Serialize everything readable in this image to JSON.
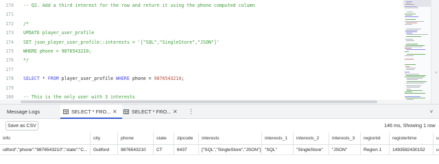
{
  "editor": {
    "lines": [
      {
        "num": "170",
        "tokens": [
          {
            "t": "-- Q2. Add a third interest for the row and return it using the phone computed column",
            "k": "comment"
          }
        ]
      },
      {
        "num": "171",
        "tokens": []
      },
      {
        "num": "172",
        "tokens": [
          {
            "t": "/*",
            "k": "comment"
          }
        ]
      },
      {
        "num": "173",
        "tokens": [
          {
            "t": "UPDATE player_user_profile",
            "k": "comment"
          }
        ]
      },
      {
        "num": "174",
        "tokens": [
          {
            "t": "SET json_player_user_profile::interests = '[\"SQL\",\"SingleStore\",\"JSON\"]'",
            "k": "comment"
          }
        ]
      },
      {
        "num": "175",
        "tokens": [
          {
            "t": "WHERE phone = 9876543210;",
            "k": "comment"
          }
        ]
      },
      {
        "num": "176",
        "tokens": [
          {
            "t": "*/",
            "k": "comment"
          }
        ]
      },
      {
        "num": "177",
        "tokens": []
      },
      {
        "num": "178",
        "tokens": [
          {
            "t": "SELECT",
            "k": "keyword"
          },
          {
            "t": " * ",
            "k": "plain"
          },
          {
            "t": "FROM",
            "k": "keyword"
          },
          {
            "t": " player_user_profile ",
            "k": "plain"
          },
          {
            "t": "WHERE",
            "k": "keyword"
          },
          {
            "t": " phone = ",
            "k": "plain"
          },
          {
            "t": "9876543210",
            "k": "number"
          },
          {
            "t": ";",
            "k": "plain"
          }
        ]
      },
      {
        "num": "179",
        "tokens": []
      },
      {
        "num": "180",
        "tokens": [
          {
            "t": "-- This is the only user with 3 interests",
            "k": "comment"
          }
        ]
      },
      {
        "num": "181",
        "tokens": [
          {
            "t": "SELECT",
            "k": "keyword"
          },
          {
            "t": " * ",
            "k": "plain"
          },
          {
            "t": "FROM",
            "k": "keyword"
          },
          {
            "t": " player_user_profile ",
            "k": "plain"
          },
          {
            "t": "WHERE",
            "k": "keyword"
          },
          {
            "t": " JSON_LENGTH(interests) = ",
            "k": "plain"
          },
          {
            "t": "3",
            "k": "number"
          },
          {
            "t": ";",
            "k": "plain"
          }
        ]
      },
      {
        "num": "182",
        "tokens": []
      },
      {
        "num": "183",
        "tokens": []
      }
    ]
  },
  "tabs": [
    {
      "label": "Message Logs",
      "active": false,
      "has_icon": false,
      "has_close": false
    },
    {
      "label": "SELECT * FRO...",
      "active": true,
      "has_icon": true,
      "has_close": true
    },
    {
      "label": "SELECT * FRO...",
      "active": false,
      "has_icon": true,
      "has_close": true
    }
  ],
  "tab_overflow_icon": "⋮",
  "collapse_icon": "˅",
  "toolbar": {
    "save_csv_label": "Save as CSV",
    "status": "146 ms, Showing 1 row"
  },
  "results": {
    "columns": [
      "info",
      "city",
      "phone",
      "state",
      "zipcode",
      "interests",
      "interests_1",
      "interests_2",
      "interests_3",
      "regionId",
      "registertime",
      "us"
    ],
    "rows": [
      [
        "uilford\",\"phone\":\"9876543210\",\"state\":\"C...",
        "Guilford",
        "9876543210",
        "CT",
        "6437",
        "[\"SQL\",\"SingleStore\",\"JSON\"]",
        "\"SQL\"",
        "\"SingleStore\"",
        "\"JSON\"",
        "Region 1",
        "1493582430152",
        "u"
      ]
    ]
  },
  "colors": {
    "comment": "#3d9b38",
    "keyword": "#4a4ae0",
    "number": "#b14a3a",
    "active_tab_underline": "#3b5ccc"
  }
}
